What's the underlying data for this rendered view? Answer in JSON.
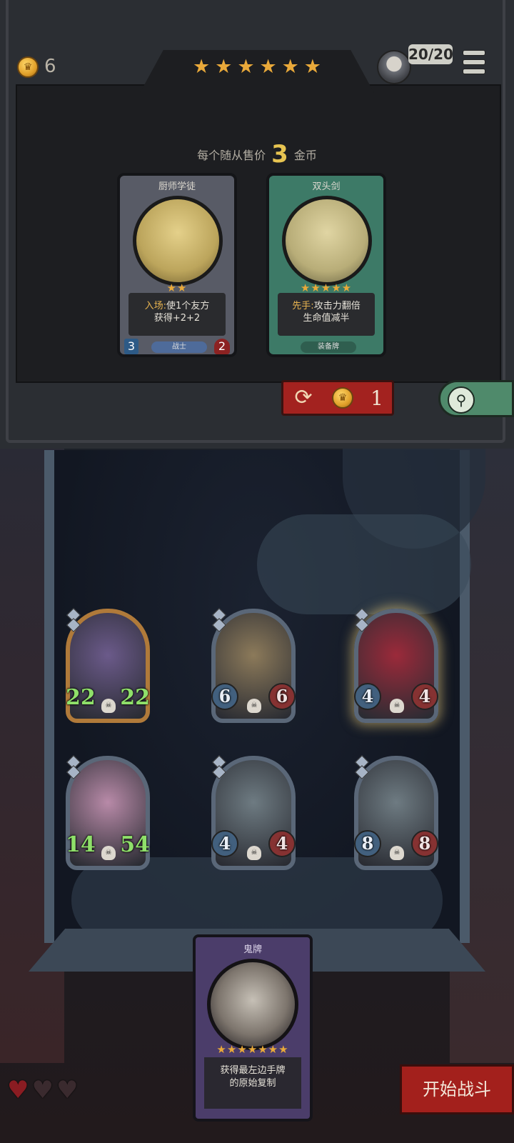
{
  "header": {
    "gold": "6",
    "star_rating": [
      "★",
      "★",
      "★",
      "★",
      "★",
      "★"
    ],
    "turn_counter": "20/20"
  },
  "shop": {
    "sale_prefix": "每个随从售价",
    "sale_price": "3",
    "sale_suffix": "金币",
    "cards": [
      {
        "name": "厨师学徒",
        "stars": "★★",
        "keyword": "入场:",
        "text_line1": "使1个友方",
        "text_line2": "获得+2+2",
        "type": "战士",
        "attack": "3",
        "health": "2",
        "frame_color": "#5c5f6a",
        "art_color": "#d7c27a"
      },
      {
        "name": "双头剑",
        "stars": "★★★★★",
        "keyword": "先手:",
        "text_line1": "攻击力翻倍",
        "text_line2": "生命值减半",
        "type": "装备牌",
        "frame_color": "#3e7d6a",
        "art_color": "#d8cd9a"
      }
    ],
    "refresh_cost": "1"
  },
  "board": {
    "minions": [
      {
        "attack": "22",
        "health": "22",
        "style": "gold",
        "stat_style": "green",
        "art_color": "#6b5a8a"
      },
      {
        "attack": "6",
        "health": "6",
        "style": "normal",
        "stat_style": "circle",
        "art_color": "#8c7a5a"
      },
      {
        "attack": "4",
        "health": "4",
        "style": "glow",
        "stat_style": "circle",
        "art_color": "#9b2a3a"
      },
      {
        "attack": "14",
        "health": "54",
        "style": "normal",
        "stat_style": "green",
        "art_color": "#b88aa8"
      },
      {
        "attack": "4",
        "health": "4",
        "style": "normal",
        "stat_style": "circle",
        "art_color": "#6e7b82"
      },
      {
        "attack": "8",
        "health": "8",
        "style": "normal",
        "stat_style": "circle",
        "art_color": "#6e7b82"
      }
    ]
  },
  "hand": {
    "name": "鬼牌",
    "stars": "★★★★★★★",
    "text_line1": "获得最左边手牌",
    "text_line2": "的原始复制"
  },
  "footer": {
    "lives": 3,
    "start_label": "开始战斗"
  }
}
